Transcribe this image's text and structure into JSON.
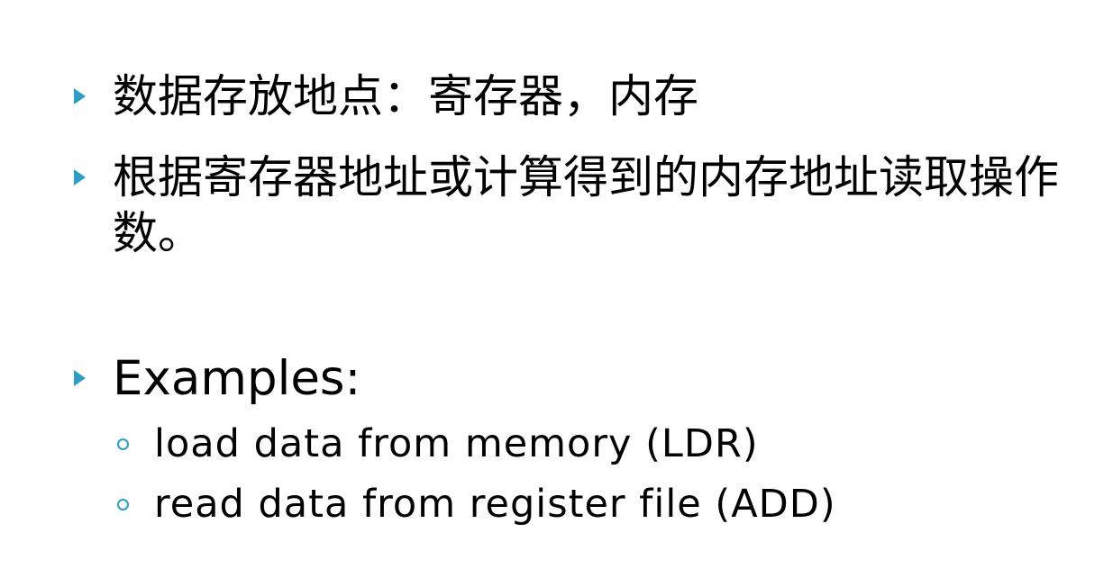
{
  "bullets": [
    {
      "text": "数据存放地点：寄存器，内存"
    },
    {
      "text": "根据寄存器地址或计算得到的内存地址读取操作数。"
    },
    {
      "text": "Examples:"
    }
  ],
  "sub_bullets": [
    {
      "text": "load data from memory (LDR)"
    },
    {
      "text": "read data from register file (ADD)"
    }
  ],
  "colors": {
    "accent": "#2e9fc4",
    "text": "#000000",
    "background": "#ffffff"
  },
  "icons": {
    "bullet": "triangle-right-icon",
    "sub_bullet": "hollow-circle-icon"
  }
}
